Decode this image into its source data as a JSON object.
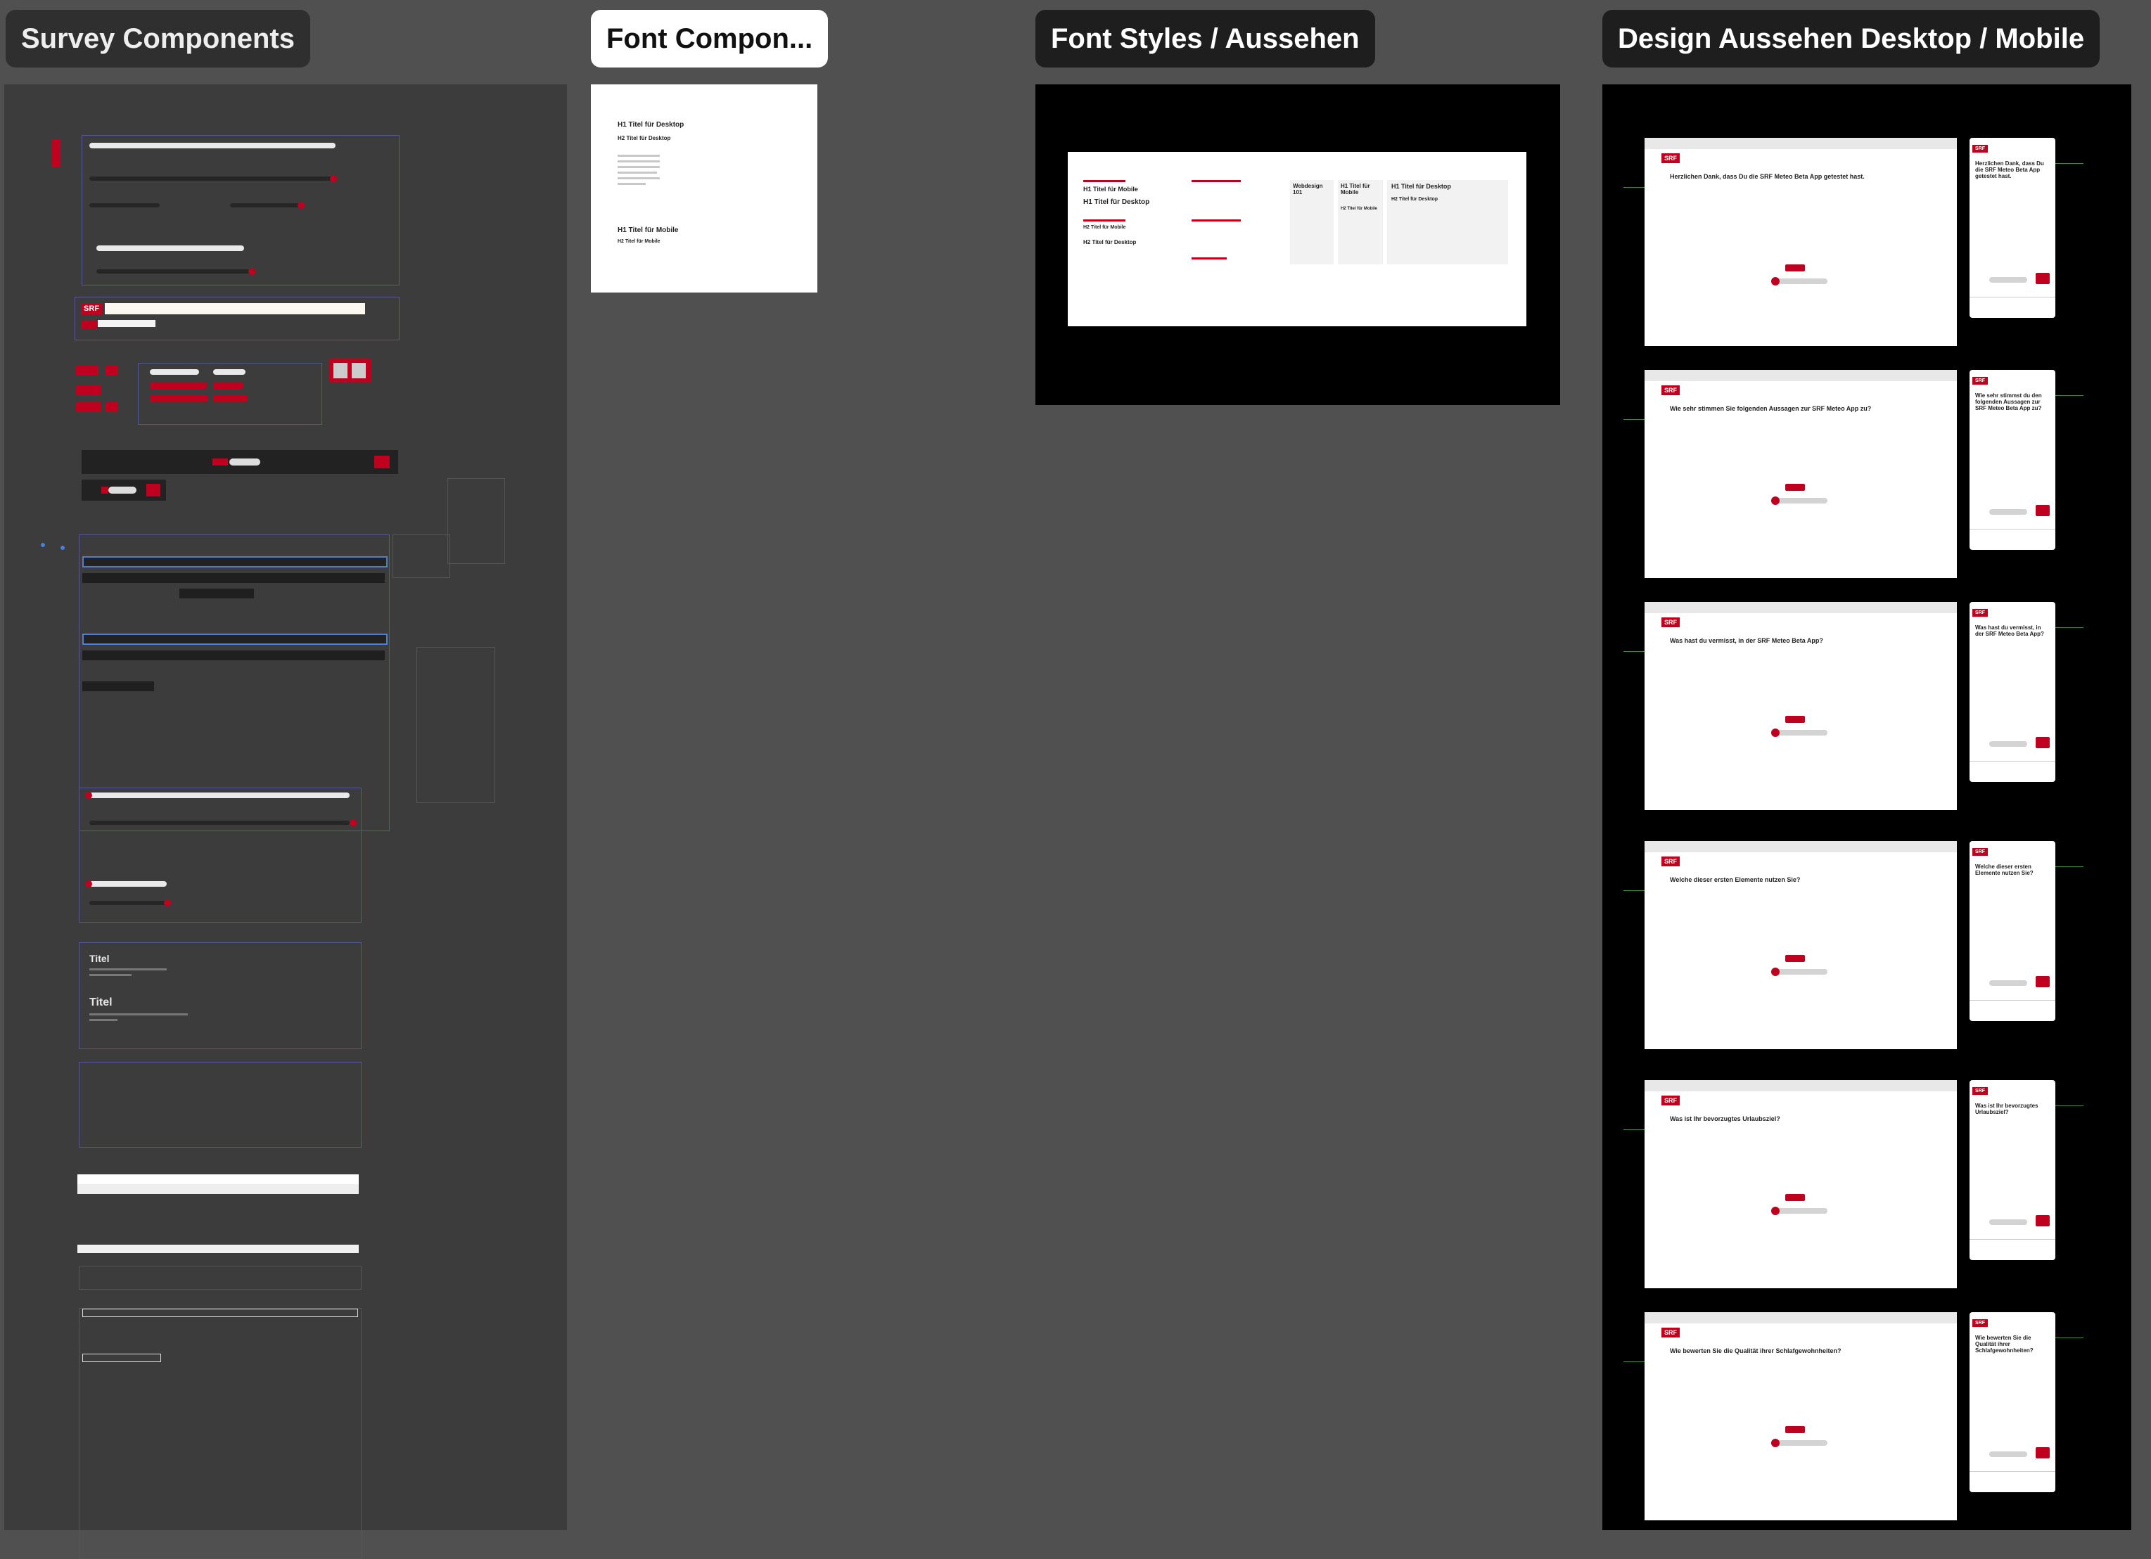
{
  "canvas": {
    "background": "#505050",
    "accent": "#c0001f"
  },
  "frames": [
    {
      "label": "Survey Components"
    },
    {
      "label": "Font Compon..."
    },
    {
      "label": "Font Styles / Aussehen"
    },
    {
      "label": "Design Aussehen Desktop / Mobile"
    }
  ],
  "font_components": {
    "h1_desktop": "H1 Titel für Desktop",
    "h2_desktop": "H2 Titel für Desktop",
    "h1_mobile": "H1 Titel für Mobile",
    "h2_mobile": "H2 Titel für Mobile"
  },
  "font_styles": {
    "h1_mobile": "H1 Titel für Mobile",
    "h1_desktop": "H1 Titel für Desktop",
    "h2_mobile": "H2 Titel für Mobile",
    "h2_desktop": "H2 Titel für Desktop",
    "webdesign": "Webdesign 101",
    "card_h1_mobile": "H1 Titel für Mobile",
    "card_h2_mobile": "H2 Titel für Mobile",
    "card_h1_desktop": "H1 Titel für Desktop",
    "card_h2_desktop": "H2 Titel für Desktop"
  },
  "survey_components": {
    "srf_logo": "SRF",
    "titel_small": "Titel",
    "titel_large": "Titel"
  },
  "screens": [
    {
      "question": "Herzlichen Dank, dass Du die SRF Meteo Beta App getestet hast.",
      "mobile_question": "Herzlichen Dank, dass Du die SRF Meteo Beta App getestet hast."
    },
    {
      "question": "Wie sehr stimmen Sie folgenden Aussagen zur SRF Meteo App zu?",
      "mobile_question": "Wie sehr stimmst du den folgenden Aussagen zur SRF Meteo Beta App zu?"
    },
    {
      "question": "Was hast du vermisst, in der SRF Meteo Beta App?",
      "mobile_question": "Was hast du vermisst, in der SRF Meteo Beta App?"
    },
    {
      "question": "Welche dieser ersten Elemente nutzen Sie?",
      "mobile_question": "Welche dieser ersten Elemente nutzen Sie?"
    },
    {
      "question": "Was ist Ihr bevorzugtes Urlaubsziel?",
      "mobile_question": "Was ist Ihr bevorzugtes Urlaubsziel?"
    },
    {
      "question": "Wie bewerten Sie die Qualität ihrer Schlafgewohnheiten?",
      "mobile_question": "Wie bewerten Sie die Qualität ihrer Schlafgewohnheiten?"
    }
  ]
}
